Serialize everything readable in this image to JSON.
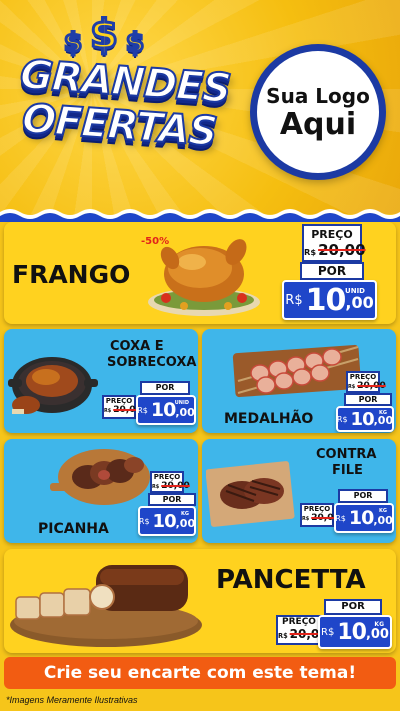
{
  "header": {
    "dollar_signs": [
      "$",
      "$",
      "$"
    ],
    "title_line1": "GRANDES",
    "title_line2": "OFERTAS",
    "logo_line1": "Sua Logo",
    "logo_line2": "Aqui"
  },
  "labels": {
    "preco": "PREÇO",
    "por": "POR",
    "currency": "R$",
    "old_currency": "R$"
  },
  "products": {
    "frango": {
      "name": "FRANGO",
      "discount": "-50%",
      "old_price": "20,00",
      "price_int": "10",
      "price_cents": ",00",
      "unit": "UNID"
    },
    "coxa": {
      "name_line1": "COXA E",
      "name_line2": "SOBRECOXA",
      "old_price": "20,00",
      "price_int": "10",
      "price_cents": ",00",
      "unit": "UNID"
    },
    "medalhao": {
      "name": "MEDALHÃO",
      "old_price": "20,00",
      "price_int": "10",
      "price_cents": ",00",
      "unit": "KG"
    },
    "picanha": {
      "name": "PICANHA",
      "old_price": "20,00",
      "price_int": "10",
      "price_cents": ",00",
      "unit": "KG"
    },
    "contrafile": {
      "name_line1": "CONTRA",
      "name_line2": "FILE",
      "old_price": "20,00",
      "price_int": "10",
      "price_cents": ",00",
      "unit": "KG"
    },
    "pancetta": {
      "name": "PANCETTA",
      "old_price": "20,00",
      "price_int": "10",
      "price_cents": ",00",
      "unit": "KG"
    }
  },
  "cta": {
    "text": "Crie seu encarte com este tema!"
  },
  "footnote": "*Imagens Meramente Ilustrativas",
  "colors": {
    "yellow": "#ffd21f",
    "blue_card": "#3fb6ea",
    "price_blue": "#1f46c9",
    "cta_orange": "#f25c12",
    "strike_red": "#e2231a"
  }
}
